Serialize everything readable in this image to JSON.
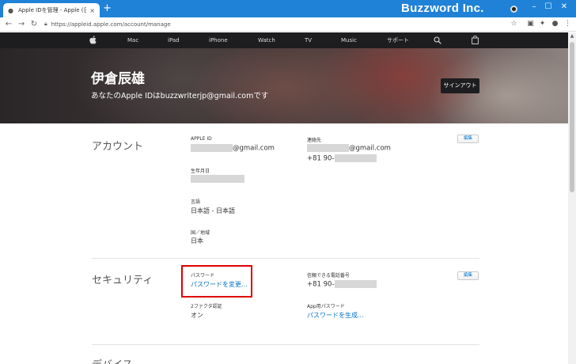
{
  "browser": {
    "tab_title": "Apple IDを管理 - Apple (日本)",
    "tab_close": "×",
    "new_tab": "+",
    "url": "https://appleid.apple.com/account/manage",
    "watermark": "Buzzword Inc.",
    "window": {
      "minimize": "–",
      "maximize": "☐",
      "close": "✕"
    }
  },
  "apple_nav": {
    "items": [
      "Mac",
      "iPad",
      "iPhone",
      "Watch",
      "TV",
      "Music",
      "サポート"
    ]
  },
  "hero": {
    "name": "伊倉辰雄",
    "subtitle": "あなたのApple IDはbuzzwriterjp@gmail.comです",
    "signout": "サインアウト"
  },
  "account": {
    "title": "アカウント",
    "apple_id_label": "APPLE ID",
    "apple_id_suffix": "@gmail.com",
    "birthday_label": "生年月日",
    "language_label": "言語",
    "language_value": "日本語 - 日本語",
    "region_label": "国／地域",
    "region_value": "日本",
    "contact_label": "連絡先",
    "contact_email_suffix": "@gmail.com",
    "contact_phone_prefix": "+81 90-",
    "edit": "編集"
  },
  "security": {
    "title": "セキュリティ",
    "password_label": "パスワード",
    "password_link": "パスワードを変更...",
    "twofa_label": "2ファクタ認証",
    "twofa_value": "オン",
    "trusted_phone_label": "信頼できる電話番号",
    "trusted_phone_prefix": "+81 90-",
    "app_password_label": "App用パスワード",
    "app_password_link": "パスワードを生成...",
    "edit": "編集"
  },
  "devices": {
    "title": "デバイス"
  }
}
